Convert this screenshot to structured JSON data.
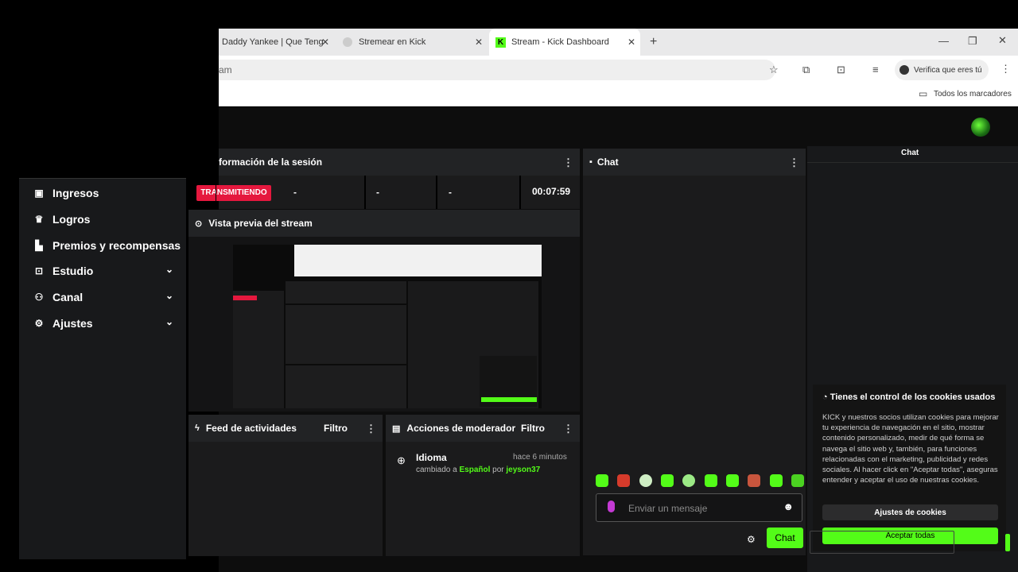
{
  "browser": {
    "tabs": [
      {
        "title": "Daddy Yankee | Que Teng"
      },
      {
        "title": "Stremear en Kick"
      },
      {
        "title": "Stream - Kick Dashboard"
      }
    ],
    "url_fragment": "am",
    "profile_label": "Verifica que eres tú",
    "bookmarks_label": "Todos los marcadores"
  },
  "sidebar": {
    "items": [
      {
        "label": "Ingresos",
        "icon": "chart-icon"
      },
      {
        "label": "Logros",
        "icon": "trophy-icon"
      },
      {
        "label": "Premios y recompensas",
        "icon": "rewards-icon"
      },
      {
        "label": "Estudio",
        "icon": "studio-icon"
      },
      {
        "label": "Canal",
        "icon": "users-icon"
      },
      {
        "label": "Ajustes",
        "icon": "gear-icon"
      }
    ]
  },
  "session": {
    "title": "formación de la sesión",
    "status": "TRANSMITIENDO",
    "stat1": "-",
    "stat2": "-",
    "stat3": "-",
    "timer": "00:07:59"
  },
  "preview": {
    "title": "Vista previa del stream"
  },
  "feed": {
    "title": "Feed de actividades",
    "filter": "Filtro"
  },
  "mod": {
    "title": "Acciones de moderador",
    "filter": "Filtro",
    "entry": {
      "title": "Idioma",
      "time": "hace 6 minutos",
      "text1": "cambiado a",
      "value": "Español",
      "text2": "por",
      "user": "jeyson37"
    }
  },
  "chat": {
    "title": "Chat",
    "side_label": "Chat",
    "placeholder": "Enviar un mensaje",
    "send_label": "Chat"
  },
  "cookies": {
    "title": "Tienes el control de los cookies usados",
    "body": "KICK y nuestros socios utilizan cookies para mejorar tu experiencia de navegación en el sitio, mostrar contenido personalizado, medir de qué forma se navega el sitio web y, también, para funciones relacionadas con el marketing, publicidad y redes sociales. Al hacer click en \"Aceptar todas\", aseguras entender y aceptar el uso de nuestras cookies.",
    "settings_label": "Ajustes de cookies",
    "accept_label": "Aceptar todas"
  },
  "colors": {
    "accent": "#53fc18",
    "live": "#e5183e"
  }
}
